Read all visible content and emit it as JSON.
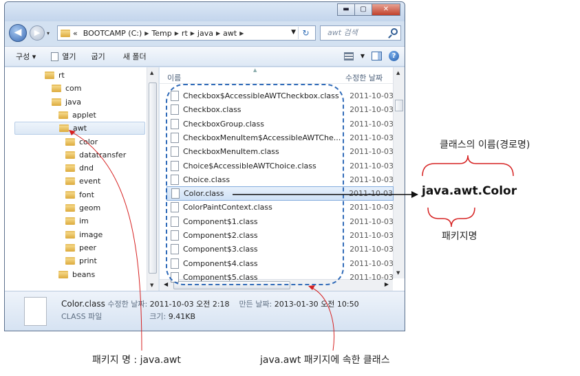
{
  "window": {
    "address": {
      "crumbs": [
        "«",
        "BOOTCAMP (C:)",
        "Temp",
        "rt",
        "java",
        "awt"
      ],
      "search_placeholder": "awt 검색"
    },
    "toolbar": {
      "organize": "구성 ▾",
      "open": "열기",
      "burn": "굽기",
      "new_folder": "새 폴더"
    },
    "tree": [
      {
        "label": "rt",
        "level": 0
      },
      {
        "label": "com",
        "level": 1
      },
      {
        "label": "java",
        "level": 1
      },
      {
        "label": "applet",
        "level": 2
      },
      {
        "label": "awt",
        "level": 2,
        "selected": true
      },
      {
        "label": "color",
        "level": 3
      },
      {
        "label": "datatransfer",
        "level": 3
      },
      {
        "label": "dnd",
        "level": 3
      },
      {
        "label": "event",
        "level": 3
      },
      {
        "label": "font",
        "level": 3
      },
      {
        "label": "geom",
        "level": 3
      },
      {
        "label": "im",
        "level": 3
      },
      {
        "label": "image",
        "level": 3
      },
      {
        "label": "peer",
        "level": 3
      },
      {
        "label": "print",
        "level": 3
      },
      {
        "label": "beans",
        "level": 2
      }
    ],
    "columns": {
      "name": "이름",
      "date": "수정한 날짜"
    },
    "files": [
      {
        "name": "Checkbox$AccessibleAWTCheckbox.class",
        "date": "2011-10-03"
      },
      {
        "name": "Checkbox.class",
        "date": "2011-10-03"
      },
      {
        "name": "CheckboxGroup.class",
        "date": "2011-10-03"
      },
      {
        "name": "CheckboxMenuItem$AccessibleAWTChe...",
        "date": "2011-10-03"
      },
      {
        "name": "CheckboxMenuItem.class",
        "date": "2011-10-03"
      },
      {
        "name": "Choice$AccessibleAWTChoice.class",
        "date": "2011-10-03"
      },
      {
        "name": "Choice.class",
        "date": "2011-10-03"
      },
      {
        "name": "Color.class",
        "date": "2011-10-03",
        "selected": true
      },
      {
        "name": "ColorPaintContext.class",
        "date": "2011-10-03"
      },
      {
        "name": "Component$1.class",
        "date": "2011-10-03"
      },
      {
        "name": "Component$2.class",
        "date": "2011-10-03"
      },
      {
        "name": "Component$3.class",
        "date": "2011-10-03"
      },
      {
        "name": "Component$4.class",
        "date": "2011-10-03"
      },
      {
        "name": "Component$5.class",
        "date": "2011-10-03"
      }
    ],
    "status": {
      "file_name": "Color.class",
      "modified_label": "수정한 날짜:",
      "modified_value": "2011-10-03 오전 2:18",
      "created_label": "만든 날짜:",
      "created_value": "2013-01-30 오전 10:50",
      "type": "CLASS 파일",
      "size_label": "크기:",
      "size_value": "9.41KB"
    }
  },
  "annotations": {
    "class_name_header": "클래스의 이름(경로명)",
    "full_class_name": "java.awt.Color",
    "package_name_label": "패키지명",
    "package_bottom": "패키지 명 : java.awt",
    "classes_bottom": "java.awt 패키지에 속한 클래스"
  },
  "colors": {
    "dashed_border": "#2f6ab8",
    "callout_red": "#d62020",
    "selection": "#cfe1f6"
  }
}
